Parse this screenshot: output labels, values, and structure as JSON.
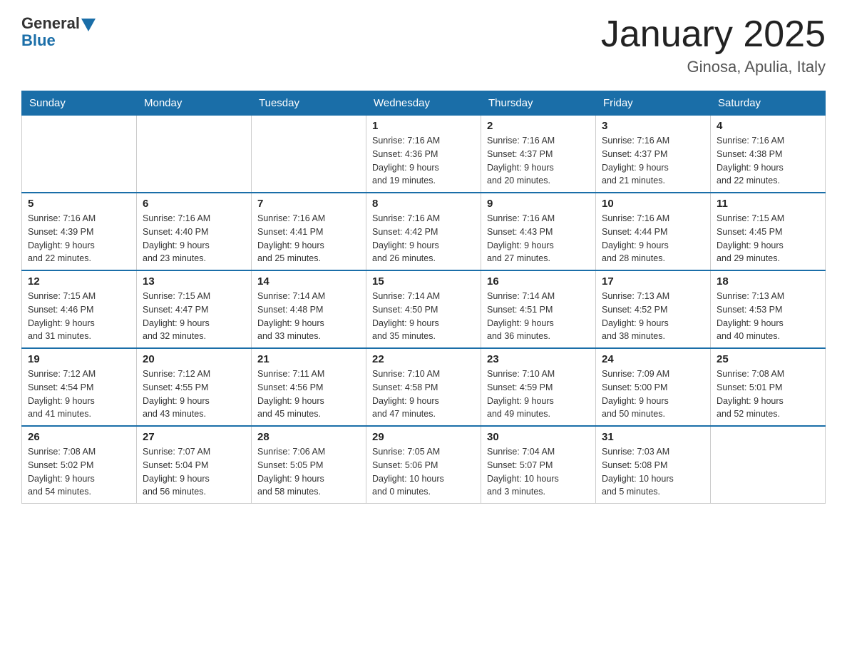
{
  "header": {
    "logo_general": "General",
    "logo_blue": "Blue",
    "title": "January 2025",
    "subtitle": "Ginosa, Apulia, Italy"
  },
  "weekdays": [
    "Sunday",
    "Monday",
    "Tuesday",
    "Wednesday",
    "Thursday",
    "Friday",
    "Saturday"
  ],
  "weeks": [
    [
      {
        "day": "",
        "info": ""
      },
      {
        "day": "",
        "info": ""
      },
      {
        "day": "",
        "info": ""
      },
      {
        "day": "1",
        "info": "Sunrise: 7:16 AM\nSunset: 4:36 PM\nDaylight: 9 hours\nand 19 minutes."
      },
      {
        "day": "2",
        "info": "Sunrise: 7:16 AM\nSunset: 4:37 PM\nDaylight: 9 hours\nand 20 minutes."
      },
      {
        "day": "3",
        "info": "Sunrise: 7:16 AM\nSunset: 4:37 PM\nDaylight: 9 hours\nand 21 minutes."
      },
      {
        "day": "4",
        "info": "Sunrise: 7:16 AM\nSunset: 4:38 PM\nDaylight: 9 hours\nand 22 minutes."
      }
    ],
    [
      {
        "day": "5",
        "info": "Sunrise: 7:16 AM\nSunset: 4:39 PM\nDaylight: 9 hours\nand 22 minutes."
      },
      {
        "day": "6",
        "info": "Sunrise: 7:16 AM\nSunset: 4:40 PM\nDaylight: 9 hours\nand 23 minutes."
      },
      {
        "day": "7",
        "info": "Sunrise: 7:16 AM\nSunset: 4:41 PM\nDaylight: 9 hours\nand 25 minutes."
      },
      {
        "day": "8",
        "info": "Sunrise: 7:16 AM\nSunset: 4:42 PM\nDaylight: 9 hours\nand 26 minutes."
      },
      {
        "day": "9",
        "info": "Sunrise: 7:16 AM\nSunset: 4:43 PM\nDaylight: 9 hours\nand 27 minutes."
      },
      {
        "day": "10",
        "info": "Sunrise: 7:16 AM\nSunset: 4:44 PM\nDaylight: 9 hours\nand 28 minutes."
      },
      {
        "day": "11",
        "info": "Sunrise: 7:15 AM\nSunset: 4:45 PM\nDaylight: 9 hours\nand 29 minutes."
      }
    ],
    [
      {
        "day": "12",
        "info": "Sunrise: 7:15 AM\nSunset: 4:46 PM\nDaylight: 9 hours\nand 31 minutes."
      },
      {
        "day": "13",
        "info": "Sunrise: 7:15 AM\nSunset: 4:47 PM\nDaylight: 9 hours\nand 32 minutes."
      },
      {
        "day": "14",
        "info": "Sunrise: 7:14 AM\nSunset: 4:48 PM\nDaylight: 9 hours\nand 33 minutes."
      },
      {
        "day": "15",
        "info": "Sunrise: 7:14 AM\nSunset: 4:50 PM\nDaylight: 9 hours\nand 35 minutes."
      },
      {
        "day": "16",
        "info": "Sunrise: 7:14 AM\nSunset: 4:51 PM\nDaylight: 9 hours\nand 36 minutes."
      },
      {
        "day": "17",
        "info": "Sunrise: 7:13 AM\nSunset: 4:52 PM\nDaylight: 9 hours\nand 38 minutes."
      },
      {
        "day": "18",
        "info": "Sunrise: 7:13 AM\nSunset: 4:53 PM\nDaylight: 9 hours\nand 40 minutes."
      }
    ],
    [
      {
        "day": "19",
        "info": "Sunrise: 7:12 AM\nSunset: 4:54 PM\nDaylight: 9 hours\nand 41 minutes."
      },
      {
        "day": "20",
        "info": "Sunrise: 7:12 AM\nSunset: 4:55 PM\nDaylight: 9 hours\nand 43 minutes."
      },
      {
        "day": "21",
        "info": "Sunrise: 7:11 AM\nSunset: 4:56 PM\nDaylight: 9 hours\nand 45 minutes."
      },
      {
        "day": "22",
        "info": "Sunrise: 7:10 AM\nSunset: 4:58 PM\nDaylight: 9 hours\nand 47 minutes."
      },
      {
        "day": "23",
        "info": "Sunrise: 7:10 AM\nSunset: 4:59 PM\nDaylight: 9 hours\nand 49 minutes."
      },
      {
        "day": "24",
        "info": "Sunrise: 7:09 AM\nSunset: 5:00 PM\nDaylight: 9 hours\nand 50 minutes."
      },
      {
        "day": "25",
        "info": "Sunrise: 7:08 AM\nSunset: 5:01 PM\nDaylight: 9 hours\nand 52 minutes."
      }
    ],
    [
      {
        "day": "26",
        "info": "Sunrise: 7:08 AM\nSunset: 5:02 PM\nDaylight: 9 hours\nand 54 minutes."
      },
      {
        "day": "27",
        "info": "Sunrise: 7:07 AM\nSunset: 5:04 PM\nDaylight: 9 hours\nand 56 minutes."
      },
      {
        "day": "28",
        "info": "Sunrise: 7:06 AM\nSunset: 5:05 PM\nDaylight: 9 hours\nand 58 minutes."
      },
      {
        "day": "29",
        "info": "Sunrise: 7:05 AM\nSunset: 5:06 PM\nDaylight: 10 hours\nand 0 minutes."
      },
      {
        "day": "30",
        "info": "Sunrise: 7:04 AM\nSunset: 5:07 PM\nDaylight: 10 hours\nand 3 minutes."
      },
      {
        "day": "31",
        "info": "Sunrise: 7:03 AM\nSunset: 5:08 PM\nDaylight: 10 hours\nand 5 minutes."
      },
      {
        "day": "",
        "info": ""
      }
    ]
  ]
}
